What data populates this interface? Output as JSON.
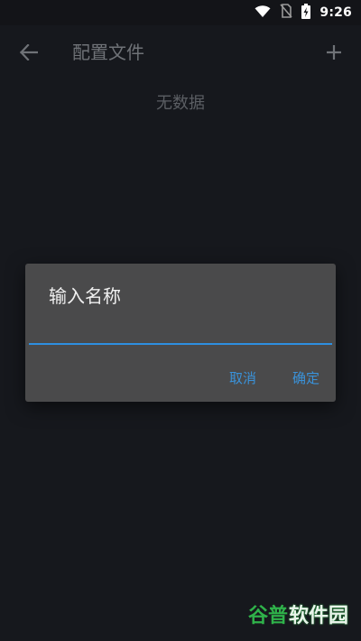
{
  "status_bar": {
    "time": "9:26",
    "icons": [
      "wifi-icon",
      "no-sim-icon",
      "battery-charging-icon"
    ]
  },
  "app_bar": {
    "title": "配置文件",
    "back_icon": "arrow-left-icon",
    "add_icon": "plus-icon"
  },
  "main": {
    "empty_text": "无数据"
  },
  "dialog": {
    "title": "输入名称",
    "input_value": "",
    "input_placeholder": "",
    "cancel_label": "取消",
    "confirm_label": "确定",
    "accent_color": "#2e8fe0"
  },
  "watermark": {
    "part1": "谷普",
    "part2": "软件园"
  }
}
